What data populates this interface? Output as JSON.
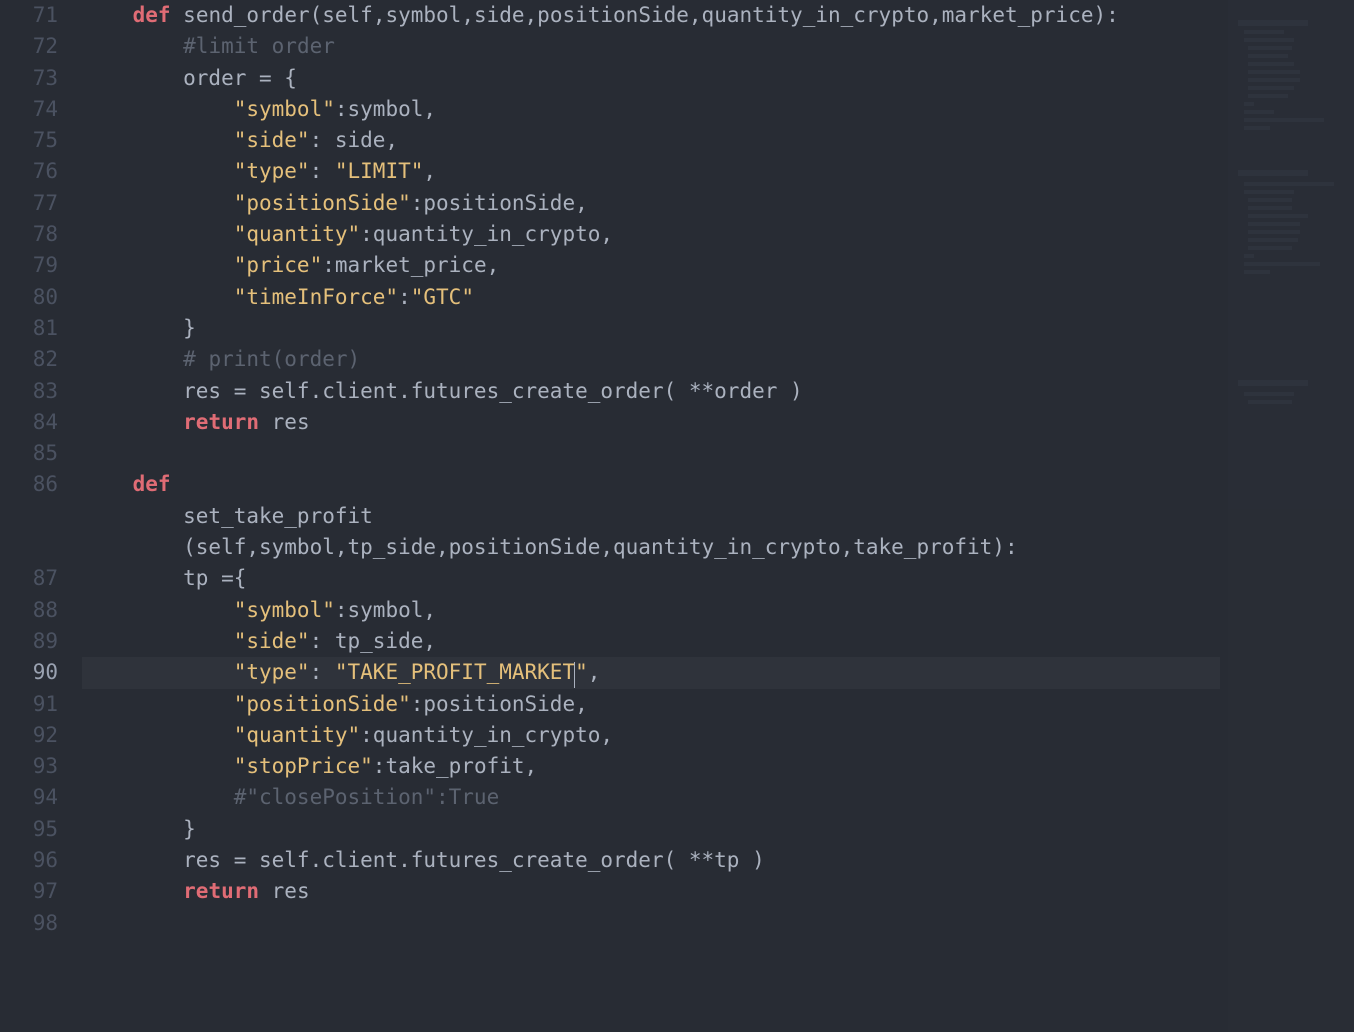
{
  "editor": {
    "first_line_number": 71,
    "active_line_index": 19,
    "lines": [
      [
        [
          "    ",
          ""
        ],
        [
          "def",
          "kw"
        ],
        [
          " ",
          ""
        ],
        [
          "send_order",
          "fn"
        ],
        [
          "(self,symbol,side,positionSide,quantity_in_crypto,market_price):",
          "id"
        ]
      ],
      [
        [
          "        ",
          ""
        ],
        [
          "#limit order",
          "cmt"
        ]
      ],
      [
        [
          "        order = {",
          "id"
        ]
      ],
      [
        [
          "            ",
          ""
        ],
        [
          "\"symbol\"",
          "str"
        ],
        [
          ":symbol,",
          "id"
        ]
      ],
      [
        [
          "            ",
          ""
        ],
        [
          "\"side\"",
          "str"
        ],
        [
          ": side,",
          "id"
        ]
      ],
      [
        [
          "            ",
          ""
        ],
        [
          "\"type\"",
          "str"
        ],
        [
          ": ",
          "id"
        ],
        [
          "\"LIMIT\"",
          "str"
        ],
        [
          ",",
          "id"
        ]
      ],
      [
        [
          "            ",
          ""
        ],
        [
          "\"positionSide\"",
          "str"
        ],
        [
          ":positionSide,",
          "id"
        ]
      ],
      [
        [
          "            ",
          ""
        ],
        [
          "\"quantity\"",
          "str"
        ],
        [
          ":quantity_in_crypto,",
          "id"
        ]
      ],
      [
        [
          "            ",
          ""
        ],
        [
          "\"price\"",
          "str"
        ],
        [
          ":market_price,",
          "id"
        ]
      ],
      [
        [
          "            ",
          ""
        ],
        [
          "\"timeInForce\"",
          "str"
        ],
        [
          ":",
          "id"
        ],
        [
          "\"GTC\"",
          "str"
        ]
      ],
      [
        [
          "        }",
          "id"
        ]
      ],
      [
        [
          "        ",
          ""
        ],
        [
          "# print(order)",
          "cmt"
        ]
      ],
      [
        [
          "        res = self.client.futures_create_order( **order )",
          "id"
        ]
      ],
      [
        [
          "        ",
          ""
        ],
        [
          "return",
          "kw"
        ],
        [
          " res",
          "id"
        ]
      ],
      [
        [
          "",
          ""
        ]
      ],
      [
        [
          "    ",
          ""
        ],
        [
          "def",
          "kw"
        ]
      ],
      [
        [
          "        set_take_profit",
          "fn"
        ]
      ],
      [
        [
          "        (self,symbol,tp_side,positionSide,quantity_in_crypto,take_profit):",
          "id"
        ]
      ],
      [
        [
          "        tp ={",
          "id"
        ]
      ],
      [
        [
          "            ",
          ""
        ],
        [
          "\"symbol\"",
          "str"
        ],
        [
          ":symbol,",
          "id"
        ]
      ],
      [
        [
          "            ",
          ""
        ],
        [
          "\"side\"",
          "str"
        ],
        [
          ": tp_side,",
          "id"
        ]
      ],
      [
        [
          "            ",
          ""
        ],
        [
          "\"type\"",
          "str"
        ],
        [
          ": ",
          "id"
        ],
        [
          "\"TAKE_PROFIT_MARKET",
          "str"
        ],
        [
          "",
          "cursor"
        ],
        [
          "\"",
          "str"
        ],
        [
          ",",
          "id"
        ]
      ],
      [
        [
          "            ",
          ""
        ],
        [
          "\"positionSide\"",
          "str"
        ],
        [
          ":positionSide,",
          "id"
        ]
      ],
      [
        [
          "            ",
          ""
        ],
        [
          "\"quantity\"",
          "str"
        ],
        [
          ":quantity_in_crypto,",
          "id"
        ]
      ],
      [
        [
          "            ",
          ""
        ],
        [
          "\"stopPrice\"",
          "str"
        ],
        [
          ":take_profit,",
          "id"
        ]
      ],
      [
        [
          "            ",
          ""
        ],
        [
          "#\"closePosition\":True",
          "cmt"
        ]
      ],
      [
        [
          "        }",
          "id"
        ]
      ],
      [
        [
          "        res = self.client.futures_create_order( **tp )",
          "id"
        ]
      ],
      [
        [
          "        ",
          ""
        ],
        [
          "return",
          "kw"
        ],
        [
          " res",
          "id"
        ]
      ],
      [
        [
          "",
          ""
        ]
      ]
    ],
    "gutter_numbers": [
      "71",
      "72",
      "73",
      "74",
      "75",
      "76",
      "77",
      "78",
      "79",
      "80",
      "81",
      "82",
      "83",
      "84",
      "85",
      "86",
      "",
      "",
      "87",
      "88",
      "89",
      "90",
      "91",
      "92",
      "93",
      "94",
      "95",
      "96",
      "97",
      "98"
    ],
    "active_gutter_index": 21
  }
}
